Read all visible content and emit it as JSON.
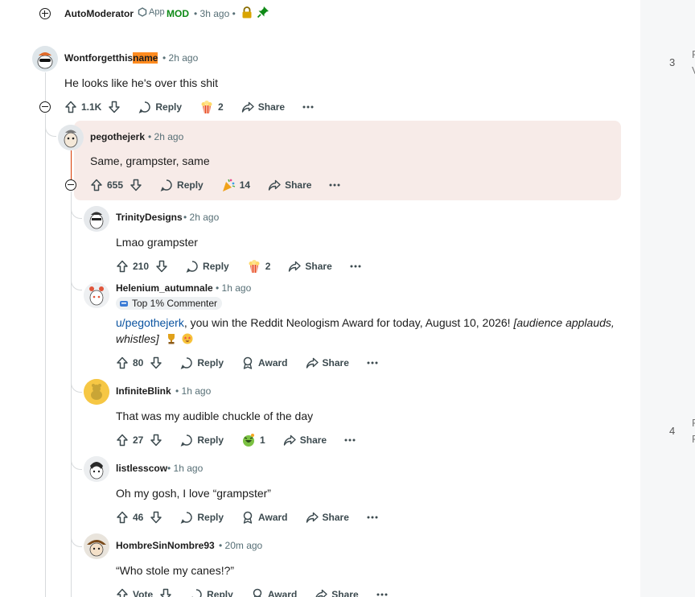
{
  "automod": {
    "username": "AutoModerator",
    "app_label": "App",
    "mod_label": "MOD",
    "time": "• 3h ago •",
    "lock_icon": "lock-icon",
    "pin_icon": "pin-icon"
  },
  "comments": [
    {
      "username_a": "Wontforgetthis",
      "username_b": "name",
      "time": "• 2h ago",
      "text": "He looks like he's over this shit",
      "votes": "1.1K",
      "reply": "Reply",
      "award_count": "2",
      "share": "Share"
    },
    {
      "username": "pegothejerk",
      "time": "• 2h ago",
      "text": "Same, grampster, same",
      "votes": "655",
      "reply": "Reply",
      "award_count": "14",
      "share": "Share"
    },
    {
      "username": "TrinityDesigns",
      "time": "• 2h ago",
      "text": "Lmao grampster",
      "votes": "210",
      "reply": "Reply",
      "award_count": "2",
      "share": "Share"
    },
    {
      "username": "Helenium_autumnale",
      "time": "• 1h ago",
      "flair": "Top 1% Commenter",
      "link": "u/pegothejerk",
      "text": ", you win the Reddit Neologism Award for today, August 10, 2026!",
      "italic": "[audience applauds,",
      "text_line2_italic": "whistles]",
      "votes": "80",
      "reply": "Reply",
      "award": "Award",
      "share": "Share"
    },
    {
      "username": "InfiniteBlink",
      "time": "• 1h ago",
      "text": "That was my audible chuckle of the day",
      "votes": "27",
      "reply": "Reply",
      "award_count": "1",
      "share": "Share"
    },
    {
      "username": "listlesscow",
      "time": "• 1h ago",
      "text": "Oh my gosh, I love “grampster”",
      "votes": "46",
      "reply": "Reply",
      "award": "Award",
      "share": "Share"
    },
    {
      "username": "HombreSinNombre93",
      "time": "• 20m ago",
      "text": "“Who stole my canes!?”",
      "votes": "Vote",
      "reply": "Reply",
      "award": "Award",
      "share": "Share"
    }
  ],
  "sidebar": {
    "num1": "3",
    "num2": "4",
    "clip1a": "F",
    "clip1b": "V",
    "clip2a": "F",
    "clip2b": "F"
  },
  "colors": {
    "highlight_bg": "#f7ebe8",
    "mod_green": "#0e8a16",
    "link_blue": "#0a53a0",
    "name_highlight": "#ff8b1f"
  }
}
